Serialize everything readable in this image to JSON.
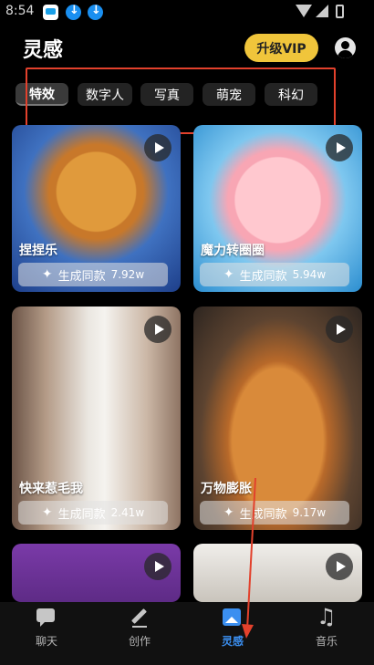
{
  "status_bar": {
    "time": "8:54"
  },
  "header": {
    "title": "灵感",
    "vip_label": "升级VIP"
  },
  "tabs": [
    {
      "label": "特效",
      "active": true
    },
    {
      "label": "数字人",
      "active": false
    },
    {
      "label": "写真",
      "active": false
    },
    {
      "label": "萌宠",
      "active": false
    },
    {
      "label": "科幻",
      "active": false
    }
  ],
  "cards": [
    {
      "title": "捏捏乐",
      "button_label": "生成同款",
      "count": "7.92w"
    },
    {
      "title": "魔力转圈圈",
      "button_label": "生成同款",
      "count": "5.94w"
    },
    {
      "title": "快来惹毛我",
      "button_label": "生成同款",
      "count": "2.41w"
    },
    {
      "title": "万物膨胀",
      "button_label": "生成同款",
      "count": "9.17w"
    }
  ],
  "bottom_nav": [
    {
      "label": "聊天",
      "icon": "chat-icon"
    },
    {
      "label": "创作",
      "icon": "pencil-icon"
    },
    {
      "label": "灵感",
      "icon": "image-icon",
      "active": true
    },
    {
      "label": "音乐",
      "icon": "music-icon"
    }
  ],
  "colors": {
    "vip": "#f0c53b",
    "accent": "#3b8ff0",
    "annotation": "#e2412c"
  }
}
